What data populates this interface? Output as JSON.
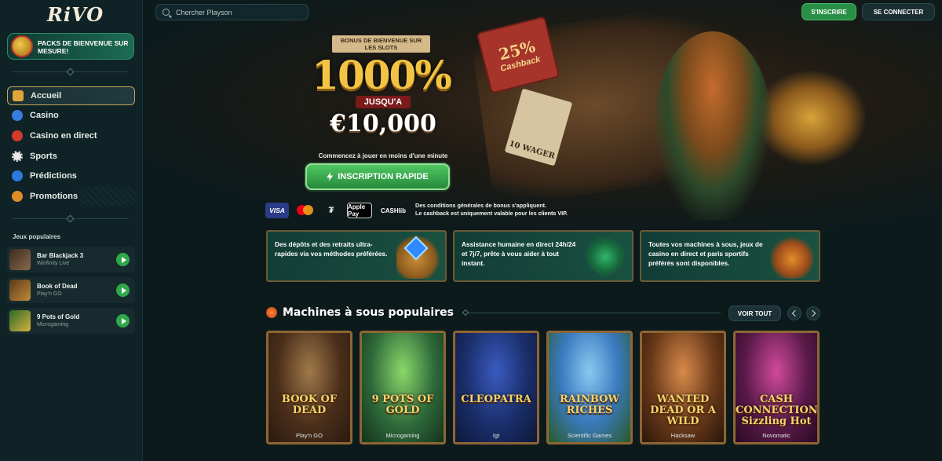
{
  "app": {
    "logo": "RiVO"
  },
  "sidebar": {
    "promo": "PACKS DE BIENVENUE SUR MESURE!",
    "nav": [
      {
        "label": "Accueil",
        "icon": "home-icon",
        "color": "#e0a63a"
      },
      {
        "label": "Casino",
        "icon": "casino-chip-icon",
        "color": "#3a7be0"
      },
      {
        "label": "Casino en direct",
        "icon": "roulette-icon",
        "color": "#d33a2a"
      },
      {
        "label": "Sports",
        "icon": "soccer-ball-icon",
        "color": "#e8e8e8"
      },
      {
        "label": "Prédictions",
        "icon": "globe-icon",
        "color": "#2c7bdc"
      },
      {
        "label": "Promotions",
        "icon": "gift-icon",
        "color": "#e08a2a"
      }
    ],
    "popular_label": "Jeux populaires",
    "popular_games": [
      {
        "name": "Bar Blackjack 3",
        "provider": "Winfinity Live"
      },
      {
        "name": "Book of Dead",
        "provider": "Play'n GO"
      },
      {
        "name": "9 Pots of Gold",
        "provider": "Microgaming"
      }
    ]
  },
  "topbar": {
    "search_placeholder": "Chercher Playson",
    "signup": "S'INSCRIRE",
    "login": "SE CONNECTER"
  },
  "hero": {
    "banner_title": "BONUS DE BIENVENUE SUR LES SLOTS",
    "percent": "1000%",
    "up_to": "JUSQU'A",
    "amount": "€10,000",
    "subtitle": "Commencez à jouer en moins d'une minute",
    "cta": "INSCRIPTION RAPIDE",
    "book_pct": "25%",
    "book_label": "Cashback",
    "wanted_label": "10 WAGER",
    "payments": [
      "VISA",
      "mastercard",
      "tether",
      "Apple Pay",
      "CASHlib"
    ],
    "note_line1": "Des conditions générales de bonus s'appliquent.",
    "note_line2_prefix": "Le cashback est uniquement valable pour les ",
    "note_line2_bold": "clients VIP."
  },
  "features": [
    {
      "text": "Des dépôts et des retraits ultra-rapides via vos méthodes préférées.",
      "art": "money-bag-icon"
    },
    {
      "text": "Assistance humaine en direct 24h/24 et 7j/7, prête à vous aider à tout instant.",
      "art": "support-shield-icon"
    },
    {
      "text": "Toutes vos machines à sous, jeux de casino en direct et paris sportifs préférés sont disponibles.",
      "art": "slot-machine-icon"
    }
  ],
  "popular_slots": {
    "title": "Machines à sous populaires",
    "see_all": "VOIR TOUT",
    "cards": [
      {
        "name": "BOOK OF DEAD",
        "provider": "Play'n GO",
        "bg": "#4a2e1a"
      },
      {
        "name": "9 POTS OF GOLD",
        "provider": "Microgaming",
        "bg": "#2e6a3a"
      },
      {
        "name": "CLEOPATRA",
        "provider": "Igt",
        "bg": "#1a2e6a"
      },
      {
        "name": "RAINBOW RICHES",
        "provider": "Scientific Games",
        "bg": "#3a7ac0"
      },
      {
        "name": "WANTED DEAD OR A WILD",
        "provider": "Hacksaw",
        "bg": "#6a3a1a"
      },
      {
        "name": "CASH CONNECTION Sizzling Hot",
        "provider": "Novomatic",
        "bg": "#5a1a4a"
      }
    ]
  }
}
